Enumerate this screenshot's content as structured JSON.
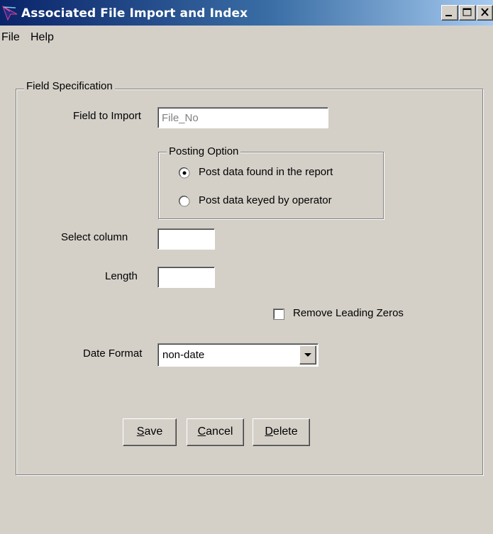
{
  "window": {
    "title": "Associated File Import and Index",
    "icon": "app-icon",
    "controls": [
      "minimize",
      "maximize",
      "close"
    ]
  },
  "menu": {
    "items": [
      "File",
      "Help"
    ]
  },
  "field_spec": {
    "group_label": "Field Specification",
    "field_to_import_label": "Field to Import",
    "field_to_import_value": "File_No",
    "posting": {
      "group_label": "Posting Option",
      "options": [
        {
          "label": "Post data found in the report",
          "selected": true
        },
        {
          "label": "Post data keyed by operator",
          "selected": false
        }
      ]
    },
    "select_column_label": "Select column",
    "select_column_value": "",
    "length_label": "Length",
    "length_value": "",
    "remove_zeros_label": "Remove Leading Zeros",
    "remove_zeros_checked": false,
    "date_format_label": "Date Format",
    "date_format_value": "non-date"
  },
  "buttons": {
    "save": {
      "mnemonic": "S",
      "rest": "ave"
    },
    "cancel": {
      "mnemonic": "C",
      "rest": "ancel"
    },
    "delete": {
      "mnemonic": "D",
      "rest": "elete"
    }
  }
}
